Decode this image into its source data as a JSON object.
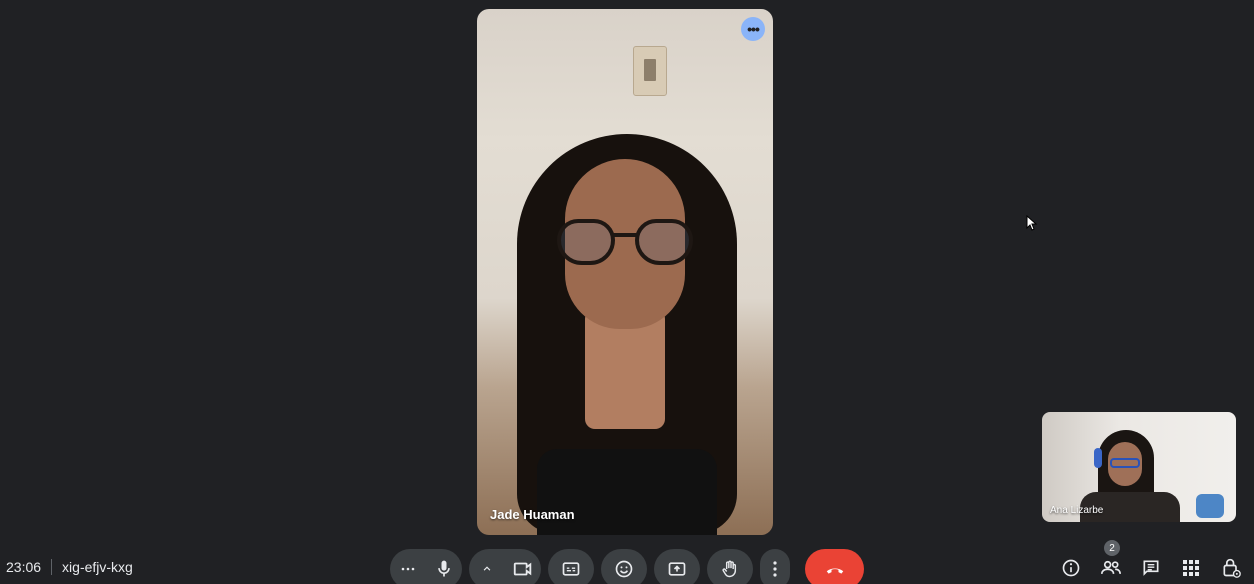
{
  "main_participant": {
    "name": "Jade Huaman",
    "more_options_icon": "more-horiz-icon",
    "accent_color": "#8ab4f8"
  },
  "self_view": {
    "name": "Ana Lizarbe"
  },
  "meeting": {
    "time": "23:06",
    "code": "xig-efjv-kxg"
  },
  "controls": {
    "icons": [
      "more-horiz-icon",
      "mic-icon",
      "chevron-up-icon",
      "videocam-icon",
      "closed-captions-icon",
      "emoji-icon",
      "present-screen-icon",
      "raise-hand-icon",
      "more-vert-icon",
      "call-end-icon"
    ],
    "end_call_color": "#ea4335"
  },
  "right_panel": {
    "participants_count": "2",
    "icons": [
      "info-icon",
      "people-icon",
      "chat-icon",
      "activities-icon",
      "host-controls-icon"
    ]
  }
}
